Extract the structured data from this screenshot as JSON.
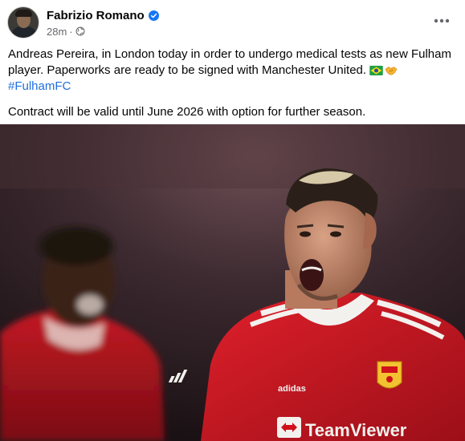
{
  "post": {
    "author": "Fabrizio Romano",
    "timestamp": "28m",
    "separator": "·",
    "text_line_1": "Andreas Pereira, in London today in order to undergo medical tests as new Fulham player. Paperworks are ready to be signed with Manchester United.",
    "hashtag": "#FulhamFC",
    "text_paragraph_2": "Contract will be valid until June 2026 with option for further season."
  },
  "photo": {
    "sponsor_text": "TeamViewer",
    "kit_brand": "adidas"
  },
  "icons": {
    "verified": "verified-badge-icon",
    "audience": "globe-icon",
    "more": "more-options-icon",
    "flag": "brazil-flag-icon",
    "handshake": "handshake-icon"
  },
  "colors": {
    "verified_blue": "#1877f2",
    "hashtag_blue": "#216fdb",
    "meta_gray": "#65676b",
    "kit_red": "#d0101a"
  }
}
